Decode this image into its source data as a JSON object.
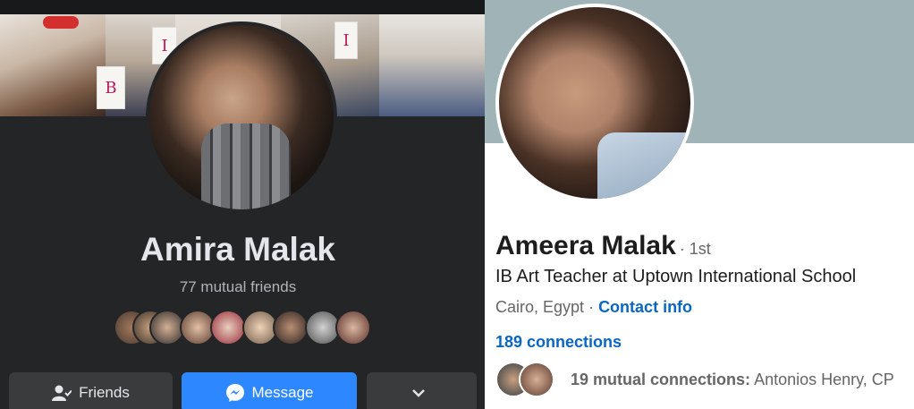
{
  "facebook": {
    "name": "Amira Malak",
    "mutual_friends": "77 mutual friends",
    "buttons": {
      "friends": "Friends",
      "message": "Message"
    },
    "icons": [
      "friends-icon",
      "messenger-icon",
      "chevron-down-icon"
    ],
    "colors": {
      "background": "#242526",
      "message_button": "#2d88ff",
      "secondary_button": "#3a3b3c"
    }
  },
  "linkedin": {
    "name": "Ameera Malak",
    "degree": "· 1st",
    "headline": "IB Art Teacher at Uptown International School",
    "location": "Cairo, Egypt ·",
    "contact_info": "Contact info",
    "connections": "189 connections",
    "mutual_label": "19 mutual connections:",
    "mutual_names": "Antonios Henry, CP",
    "colors": {
      "banner": "#a0b4b7",
      "link": "#0a66c2"
    }
  }
}
